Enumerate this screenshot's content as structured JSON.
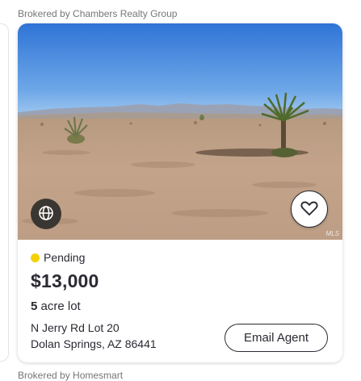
{
  "listing": {
    "brokered_by": "Brokered by Chambers Realty Group",
    "status": "Pending",
    "status_color": "#f5d000",
    "price": "$13,000",
    "lot_size": "5",
    "lot_unit": "acre lot",
    "address_line1": "N Jerry Rd Lot 20",
    "address_line2": "Dolan Springs, AZ 86441",
    "email_button": "Email Agent",
    "photo_watermark": "MLS",
    "photo_icons": {
      "globe": "globe-icon",
      "favorite": "heart-icon"
    }
  },
  "next_listing": {
    "brokered_by": "Brokered by Homesmart"
  }
}
